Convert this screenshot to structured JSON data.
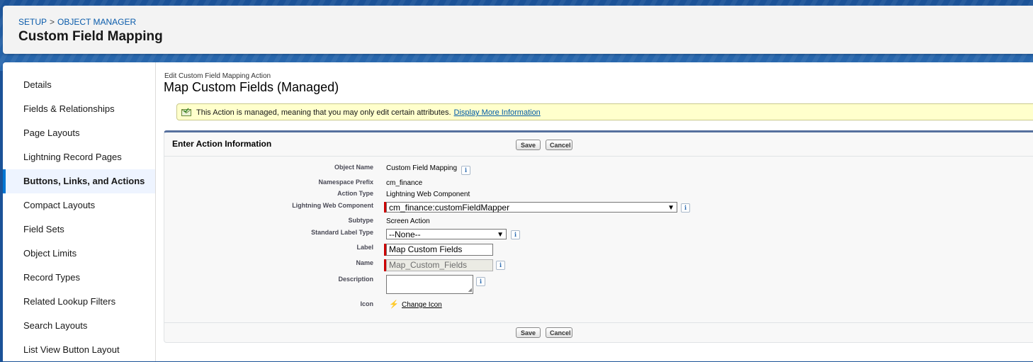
{
  "breadcrumb": {
    "setup": "SETUP",
    "separator": ">",
    "object_manager": "OBJECT MANAGER"
  },
  "page_title": "Custom Field Mapping",
  "sidebar": {
    "items": [
      {
        "label": "Details"
      },
      {
        "label": "Fields & Relationships"
      },
      {
        "label": "Page Layouts"
      },
      {
        "label": "Lightning Record Pages"
      },
      {
        "label": "Buttons, Links, and Actions",
        "active": true
      },
      {
        "label": "Compact Layouts"
      },
      {
        "label": "Field Sets"
      },
      {
        "label": "Object Limits"
      },
      {
        "label": "Record Types"
      },
      {
        "label": "Related Lookup Filters"
      },
      {
        "label": "Search Layouts"
      },
      {
        "label": "List View Button Layout"
      }
    ]
  },
  "main": {
    "subtitle": "Edit Custom Field Mapping Action",
    "title": "Map Custom Fields (Managed)",
    "notice": {
      "text": "This Action is managed, meaning that you may only edit certain attributes.",
      "link": "Display More Information"
    },
    "block": {
      "title": "Enter Action Information",
      "save_label": "Save",
      "cancel_label": "Cancel"
    },
    "fields": {
      "object_name": {
        "label": "Object Name",
        "value": "Custom Field Mapping"
      },
      "namespace_prefix": {
        "label": "Namespace Prefix",
        "value": "cm_finance"
      },
      "action_type": {
        "label": "Action Type",
        "value": "Lightning Web Component"
      },
      "lwc": {
        "label": "Lightning Web Component",
        "value": "cm_finance:customFieldMapper"
      },
      "subtype": {
        "label": "Subtype",
        "value": "Screen Action"
      },
      "standard_label_type": {
        "label": "Standard Label Type",
        "value": "--None--"
      },
      "label": {
        "label": "Label",
        "value": "Map Custom Fields"
      },
      "name": {
        "label": "Name",
        "value": "Map_Custom_Fields"
      },
      "description": {
        "label": "Description",
        "value": ""
      },
      "icon": {
        "label": "Icon",
        "link": "Change Icon"
      }
    },
    "info_glyph": "i"
  },
  "colors": {
    "brand_blue": "#1b5297",
    "active_accent": "#0176d3",
    "notice_bg": "#ffffcc",
    "required_marker": "#cc0000",
    "block_border": "#56709e"
  },
  "icons": [
    "envelope-check-icon",
    "info-icon",
    "lightning-bolt-icon",
    "chevron-down-icon"
  ]
}
